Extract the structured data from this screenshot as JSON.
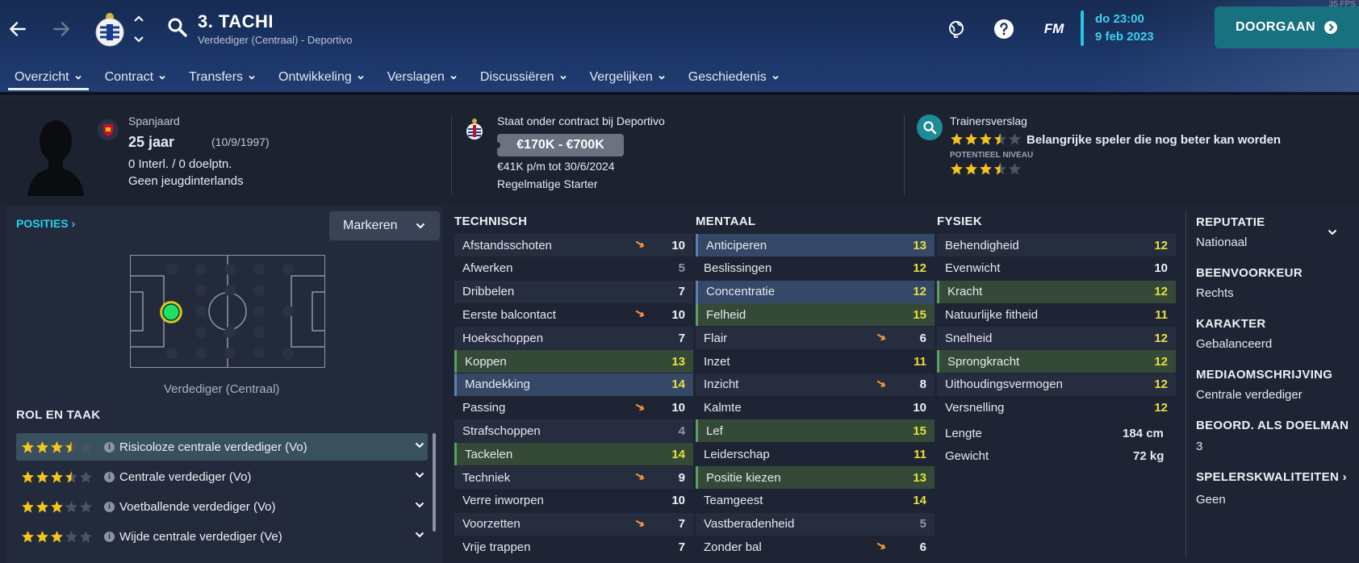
{
  "header": {
    "player_title": "3. TACHI",
    "player_subtitle": "Verdediger (Centraal) - Deportivo",
    "fm_label": "FM",
    "date_line1": "do 23:00",
    "date_line2": "9 feb 2023",
    "continue_label": "DOORGAAN",
    "fps_label": "35 FPS"
  },
  "tabs": [
    {
      "label": "Overzicht"
    },
    {
      "label": "Contract"
    },
    {
      "label": "Transfers"
    },
    {
      "label": "Ontwikkeling"
    },
    {
      "label": "Verslagen"
    },
    {
      "label": "Discussiëren"
    },
    {
      "label": "Vergelijken"
    },
    {
      "label": "Geschiedenis"
    }
  ],
  "info": {
    "nationality": "Spanjaard",
    "age": "25 jaar",
    "birthdate": "(10/9/1997)",
    "caps": "0 Interl. / 0 doelptn.",
    "youth": "Geen jeugdinterlands",
    "contract_status": "Staat onder contract bij Deportivo",
    "value_range": "€170K - €700K",
    "wage": "€41K p/m tot 30/6/2024",
    "squad_status": "Regelmatige Starter",
    "scout_title": "Trainersverslag",
    "scout_summary": "Belangrijke speler die nog beter kan worden",
    "potential_label": "POTENTIEEL NIVEAU",
    "current_stars": 3.5,
    "potential_stars": 3.5
  },
  "positions": {
    "title": "POSITIES",
    "mark_label": "Markeren",
    "position_label": "Verdediger (Centraal)"
  },
  "roles": {
    "title": "ROL EN TAAK",
    "items": [
      {
        "label": "Risicoloze centrale verdediger (Vo)",
        "stars": 3.5
      },
      {
        "label": "Centrale verdediger (Vo)",
        "stars": 3.5
      },
      {
        "label": "Voetballende verdediger (Vo)",
        "stars": 3
      },
      {
        "label": "Wijde centrale verdediger (Ve)",
        "stars": 3
      }
    ]
  },
  "technical": {
    "title": "TECHNISCH",
    "rows": [
      {
        "name": "Afstandsschoten",
        "value": "10",
        "arrow": true
      },
      {
        "name": "Afwerken",
        "value": "5"
      },
      {
        "name": "Dribbelen",
        "value": "7"
      },
      {
        "name": "Eerste balcontact",
        "value": "10",
        "arrow": true
      },
      {
        "name": "Hoekschoppen",
        "value": "7"
      },
      {
        "name": "Koppen",
        "value": "13",
        "hl": "green"
      },
      {
        "name": "Mandekking",
        "value": "14",
        "hl": "blue"
      },
      {
        "name": "Passing",
        "value": "10",
        "arrow": true
      },
      {
        "name": "Strafschoppen",
        "value": "4"
      },
      {
        "name": "Tackelen",
        "value": "14",
        "hl": "green"
      },
      {
        "name": "Techniek",
        "value": "9",
        "arrow": true
      },
      {
        "name": "Verre inworpen",
        "value": "10"
      },
      {
        "name": "Voorzetten",
        "value": "7",
        "arrow": true
      },
      {
        "name": "Vrije trappen",
        "value": "7"
      }
    ]
  },
  "mental": {
    "title": "MENTAAL",
    "rows": [
      {
        "name": "Anticiperen",
        "value": "13",
        "hl": "blue"
      },
      {
        "name": "Beslissingen",
        "value": "12"
      },
      {
        "name": "Concentratie",
        "value": "12",
        "hl": "blue"
      },
      {
        "name": "Felheid",
        "value": "15",
        "hl": "green"
      },
      {
        "name": "Flair",
        "value": "6",
        "arrow": true
      },
      {
        "name": "Inzet",
        "value": "11"
      },
      {
        "name": "Inzicht",
        "value": "8",
        "arrow": true
      },
      {
        "name": "Kalmte",
        "value": "10"
      },
      {
        "name": "Lef",
        "value": "15",
        "hl": "green"
      },
      {
        "name": "Leiderschap",
        "value": "11"
      },
      {
        "name": "Positie kiezen",
        "value": "13",
        "hl": "green"
      },
      {
        "name": "Teamgeest",
        "value": "14"
      },
      {
        "name": "Vastberadenheid",
        "value": "5"
      },
      {
        "name": "Zonder bal",
        "value": "6",
        "arrow": true
      }
    ]
  },
  "physical": {
    "title": "FYSIEK",
    "rows": [
      {
        "name": "Behendigheid",
        "value": "12"
      },
      {
        "name": "Evenwicht",
        "value": "10"
      },
      {
        "name": "Kracht",
        "value": "12",
        "hl": "green"
      },
      {
        "name": "Natuurlijke fitheid",
        "value": "11"
      },
      {
        "name": "Snelheid",
        "value": "12"
      },
      {
        "name": "Sprongkracht",
        "value": "12",
        "hl": "green"
      },
      {
        "name": "Uithoudingsvermogen",
        "value": "12"
      },
      {
        "name": "Versnelling",
        "value": "12"
      }
    ],
    "height_label": "Lengte",
    "height_value": "184 cm",
    "weight_label": "Gewicht",
    "weight_value": "72 kg"
  },
  "details": [
    {
      "title": "REPUTATIE",
      "value": "Nationaal"
    },
    {
      "title": "BEENVOORKEUR",
      "value": "Rechts"
    },
    {
      "title": "KARAKTER",
      "value": "Gebalanceerd"
    },
    {
      "title": "MEDIAOMSCHRIJVING",
      "value": "Centrale verdediger"
    },
    {
      "title": "BEOORD. ALS DOELMAN",
      "value": "3"
    },
    {
      "title": "SPELERSKWALITEITEN",
      "value": "Geen"
    }
  ],
  "colors": {
    "accent_cyan": "#22d3ee",
    "star_yellow": "#f5c518",
    "value_yellow": "#e5e13d",
    "continue_teal": "#18717f",
    "arrow_orange": "#f0963a",
    "player_dot": "#22dd66"
  }
}
